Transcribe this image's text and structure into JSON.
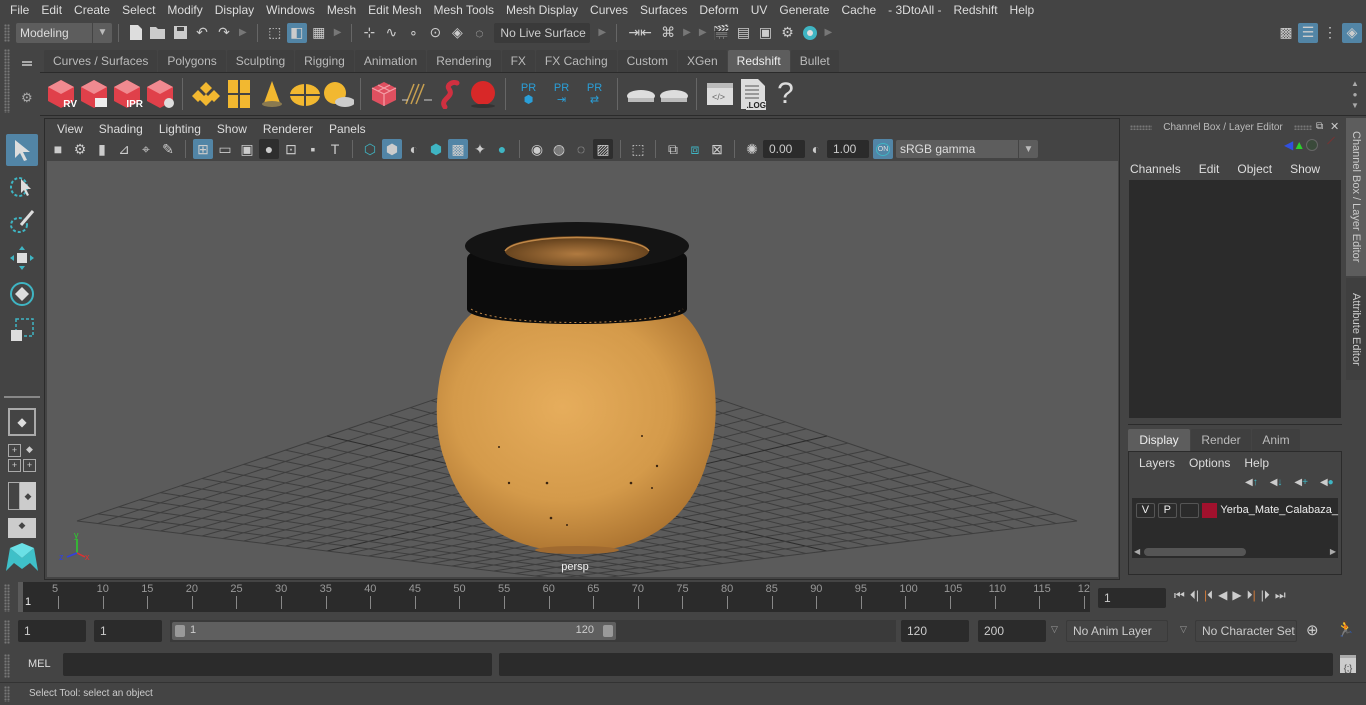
{
  "menubar": {
    "items": [
      "File",
      "Edit",
      "Create",
      "Select",
      "Modify",
      "Display",
      "Windows",
      "Mesh",
      "Edit Mesh",
      "Mesh Tools",
      "Mesh Display",
      "Curves",
      "Surfaces",
      "Deform",
      "UV",
      "Generate",
      "Cache",
      "- 3DtoAll -",
      "Redshift",
      "Help"
    ]
  },
  "statusline": {
    "workspace": "Modeling",
    "live_surface": "No Live Surface"
  },
  "shelf": {
    "tabs": [
      "Curves / Surfaces",
      "Polygons",
      "Sculpting",
      "Rigging",
      "Animation",
      "Rendering",
      "FX",
      "FX Caching",
      "Custom",
      "XGen",
      "Redshift",
      "Bullet"
    ],
    "active_tab": "Redshift",
    "icon_labels": {
      "rv": "RV",
      "ipr": "IPR",
      "pr": "PR",
      "log": ".LOG",
      "help": "?"
    }
  },
  "viewport": {
    "menu": [
      "View",
      "Shading",
      "Lighting",
      "Show",
      "Renderer",
      "Panels"
    ],
    "exposure": "0.00",
    "gamma": "1.00",
    "color_space": "sRGB gamma",
    "on_label": "ON",
    "camera_label": "persp",
    "axis": {
      "x": "x",
      "y": "y",
      "z": "z"
    }
  },
  "channel_box": {
    "title": "Channel Box / Layer Editor",
    "menu": [
      "Channels",
      "Edit",
      "Object",
      "Show"
    ]
  },
  "layer_editor": {
    "tabs": [
      "Display",
      "Render",
      "Anim"
    ],
    "active_tab": "Display",
    "menu": [
      "Layers",
      "Options",
      "Help"
    ],
    "layers": [
      {
        "v": "V",
        "p": "P",
        "color": "#a1112d",
        "name": "Yerba_Mate_Calabaza_"
      }
    ]
  },
  "side_tabs": [
    "Channel Box / Layer Editor",
    "Attribute Editor"
  ],
  "timeline": {
    "ticks": [
      "5",
      "10",
      "15",
      "20",
      "25",
      "30",
      "35",
      "40",
      "45",
      "50",
      "55",
      "60",
      "65",
      "70",
      "75",
      "80",
      "85",
      "90",
      "95",
      "100",
      "105",
      "110",
      "115",
      "12"
    ],
    "current_frame_marker": "1",
    "current_frame": "1"
  },
  "range": {
    "start": "1",
    "playback_start": "1",
    "slider_min": "1",
    "slider_max": "120",
    "playback_end": "120",
    "end": "200",
    "anim_layer": "No Anim Layer",
    "character_set": "No Character Set"
  },
  "command_line": {
    "lang": "MEL"
  },
  "help_line": {
    "text": "Select Tool: select an object"
  },
  "colors": {
    "accent": "#5285a6",
    "maya_teal": "#3fb5c3",
    "redshift_red": "#e0404a",
    "gourd": "#d49a4a"
  }
}
